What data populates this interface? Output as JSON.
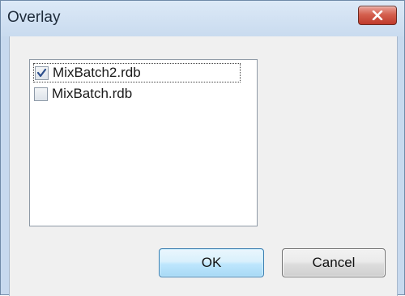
{
  "window": {
    "title": "Overlay",
    "close_icon": "close-x-icon"
  },
  "list": {
    "items": [
      {
        "label": "MixBatch2.rdb",
        "checked": true
      },
      {
        "label": "MixBatch.rdb",
        "checked": false
      }
    ]
  },
  "buttons": {
    "ok_label": "OK",
    "cancel_label": "Cancel"
  },
  "colors": {
    "titlebar": "#c9dbef",
    "close_button": "#c7473a",
    "ok_border": "#3c7fb1",
    "checkmark": "#2c4e8c"
  }
}
